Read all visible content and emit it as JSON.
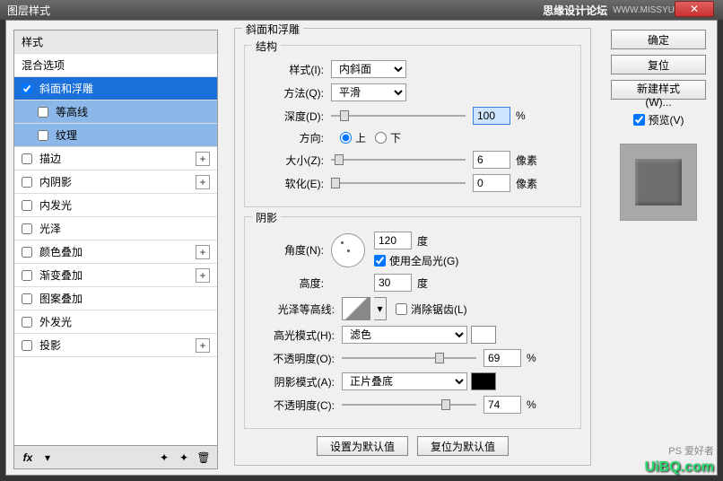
{
  "titlebar": {
    "title": "图层样式",
    "site": "思缘设计论坛",
    "url": "WWW.MISSYUAN.COM"
  },
  "sidebar": {
    "header": "样式",
    "blend": "混合选项",
    "items": [
      {
        "label": "斜面和浮雕",
        "checked": true,
        "selected": true
      },
      {
        "label": "等高线",
        "checked": false,
        "sub": true,
        "subsel": true
      },
      {
        "label": "纹理",
        "checked": false,
        "sub": true,
        "subsel": true
      },
      {
        "label": "描边",
        "checked": false,
        "plus": true
      },
      {
        "label": "内阴影",
        "checked": false,
        "plus": true
      },
      {
        "label": "内发光",
        "checked": false
      },
      {
        "label": "光泽",
        "checked": false
      },
      {
        "label": "颜色叠加",
        "checked": false,
        "plus": true
      },
      {
        "label": "渐变叠加",
        "checked": false,
        "plus": true
      },
      {
        "label": "图案叠加",
        "checked": false
      },
      {
        "label": "外发光",
        "checked": false
      },
      {
        "label": "投影",
        "checked": false,
        "plus": true
      }
    ]
  },
  "bevel": {
    "group_label": "斜面和浮雕",
    "structure_label": "结构",
    "style_label": "样式(I):",
    "style_value": "内斜面",
    "technique_label": "方法(Q):",
    "technique_value": "平滑",
    "depth_label": "深度(D):",
    "depth_value": "100",
    "depth_unit": "%",
    "direction_label": "方向:",
    "dir_up": "上",
    "dir_down": "下",
    "size_label": "大小(Z):",
    "size_value": "6",
    "size_unit": "像素",
    "soften_label": "软化(E):",
    "soften_value": "0",
    "soften_unit": "像素"
  },
  "shade": {
    "label": "阴影",
    "angle_label": "角度(N):",
    "angle_value": "120",
    "angle_unit": "度",
    "global_label": "使用全局光(G)",
    "altitude_label": "高度:",
    "altitude_value": "30",
    "altitude_unit": "度",
    "contour_label": "光泽等高线:",
    "anti_label": "消除锯齿(L)",
    "hl_mode_label": "高光模式(H):",
    "hl_mode_value": "滤色",
    "hl_color": "#ffffff",
    "hl_opacity_label": "不透明度(O):",
    "hl_opacity_value": "69",
    "hl_opacity_unit": "%",
    "sh_mode_label": "阴影模式(A):",
    "sh_mode_value": "正片叠底",
    "sh_color": "#000000",
    "sh_opacity_label": "不透明度(C):",
    "sh_opacity_value": "74",
    "sh_opacity_unit": "%"
  },
  "buttons": {
    "make_default": "设置为默认值",
    "reset_default": "复位为默认值",
    "ok": "确定",
    "cancel": "复位",
    "new_style": "新建样式(W)...",
    "preview": "预览(V)"
  },
  "watermark": {
    "logo": "PS 爱好者",
    "site": "UiBQ.com"
  }
}
